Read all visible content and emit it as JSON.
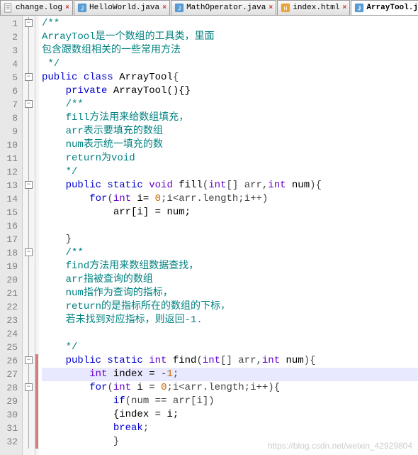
{
  "tabs": [
    {
      "label": "change.log",
      "icon": "file-icon",
      "active": false,
      "closable": true
    },
    {
      "label": "HelloWorld.java",
      "icon": "java-icon",
      "active": false,
      "closable": true
    },
    {
      "label": "MathOperator.java",
      "icon": "java-icon",
      "active": false,
      "closable": true
    },
    {
      "label": "index.html",
      "icon": "html-icon",
      "active": false,
      "closable": true
    },
    {
      "label": "ArrayTool.java",
      "icon": "java-icon",
      "active": true,
      "closable": true
    }
  ],
  "close_glyph": "×",
  "line_count": 32,
  "highlighted_line": 27,
  "fold_markers": [
    {
      "line": 1,
      "type": "minus"
    },
    {
      "line": 5,
      "type": "minus"
    },
    {
      "line": 7,
      "type": "minus"
    },
    {
      "line": 13,
      "type": "minus"
    },
    {
      "line": 18,
      "type": "minus"
    },
    {
      "line": 26,
      "type": "minus"
    },
    {
      "line": 28,
      "type": "minus"
    }
  ],
  "change_markers": [
    {
      "from": 26,
      "to": 32
    }
  ],
  "code_lines": [
    {
      "n": 1,
      "tokens": [
        {
          "t": "/**",
          "c": "c-comment"
        }
      ]
    },
    {
      "n": 2,
      "tokens": [
        {
          "t": "ArrayTool是一个数组的工具类，里面",
          "c": "c-comment"
        }
      ]
    },
    {
      "n": 3,
      "tokens": [
        {
          "t": "包含跟数组相关的一些常用方法",
          "c": "c-comment"
        }
      ]
    },
    {
      "n": 4,
      "tokens": [
        {
          "t": " */",
          "c": "c-comment"
        }
      ]
    },
    {
      "n": 5,
      "tokens": [
        {
          "t": "public ",
          "c": "c-keyword"
        },
        {
          "t": "class ",
          "c": "c-keyword"
        },
        {
          "t": "ArrayTool",
          "c": "c-id"
        },
        {
          "t": "{",
          "c": "c-op"
        }
      ]
    },
    {
      "n": 6,
      "indent": 1,
      "tokens": [
        {
          "t": "private ",
          "c": "c-keyword"
        },
        {
          "t": "ArrayTool",
          "c": "c-id"
        },
        {
          "t": "(){}"
        }
      ]
    },
    {
      "n": 7,
      "indent": 1,
      "tokens": [
        {
          "t": "/**",
          "c": "c-comment"
        }
      ]
    },
    {
      "n": 8,
      "indent": 1,
      "tokens": [
        {
          "t": "fill方法用来给数组填充，",
          "c": "c-comment"
        }
      ]
    },
    {
      "n": 9,
      "indent": 1,
      "tokens": [
        {
          "t": "arr表示要填充的数组",
          "c": "c-comment"
        }
      ]
    },
    {
      "n": 10,
      "indent": 1,
      "tokens": [
        {
          "t": "num表示统一填充的数",
          "c": "c-comment"
        }
      ]
    },
    {
      "n": 11,
      "indent": 1,
      "tokens": [
        {
          "t": "return为void",
          "c": "c-comment"
        }
      ]
    },
    {
      "n": 12,
      "indent": 1,
      "tokens": [
        {
          "t": "*/",
          "c": "c-comment"
        }
      ]
    },
    {
      "n": 13,
      "indent": 1,
      "tokens": [
        {
          "t": "public static ",
          "c": "c-keyword"
        },
        {
          "t": "void ",
          "c": "c-type"
        },
        {
          "t": "fill",
          "c": "c-id"
        },
        {
          "t": "(",
          "c": "c-op"
        },
        {
          "t": "int",
          "c": "c-type"
        },
        {
          "t": "[] arr,",
          "c": "c-op"
        },
        {
          "t": "int ",
          "c": "c-type"
        },
        {
          "t": "num",
          "c": "c-id"
        },
        {
          "t": "){",
          "c": "c-op"
        }
      ]
    },
    {
      "n": 14,
      "indent": 2,
      "tokens": [
        {
          "t": "for",
          "c": "c-keyword"
        },
        {
          "t": "(",
          "c": "c-op"
        },
        {
          "t": "int ",
          "c": "c-type"
        },
        {
          "t": "i= ",
          "c": "c-id"
        },
        {
          "t": "0",
          "c": "c-num"
        },
        {
          "t": ";i<arr.length;i++)",
          "c": "c-op"
        }
      ]
    },
    {
      "n": 15,
      "indent": 3,
      "tokens": [
        {
          "t": "arr[i] = num;",
          "c": "c-id"
        }
      ]
    },
    {
      "n": 16,
      "indent": 0,
      "tokens": []
    },
    {
      "n": 17,
      "indent": 1,
      "tokens": [
        {
          "t": "}",
          "c": "c-op"
        }
      ]
    },
    {
      "n": 18,
      "indent": 1,
      "tokens": [
        {
          "t": "/**",
          "c": "c-comment"
        }
      ]
    },
    {
      "n": 19,
      "indent": 1,
      "tokens": [
        {
          "t": "find方法用来数组数据查找，",
          "c": "c-comment"
        }
      ]
    },
    {
      "n": 20,
      "indent": 1,
      "tokens": [
        {
          "t": "arr指被查询的数组",
          "c": "c-comment"
        }
      ]
    },
    {
      "n": 21,
      "indent": 1,
      "tokens": [
        {
          "t": "num指作为查询的指标，",
          "c": "c-comment"
        }
      ]
    },
    {
      "n": 22,
      "indent": 1,
      "tokens": [
        {
          "t": "return的是指标所在的数组的下标，",
          "c": "c-comment"
        }
      ]
    },
    {
      "n": 23,
      "indent": 1,
      "tokens": [
        {
          "t": "若未找到对应指标，则返回-1.",
          "c": "c-comment"
        }
      ]
    },
    {
      "n": 24,
      "indent": 0,
      "tokens": []
    },
    {
      "n": 25,
      "indent": 1,
      "tokens": [
        {
          "t": "*/",
          "c": "c-comment"
        }
      ]
    },
    {
      "n": 26,
      "indent": 1,
      "tokens": [
        {
          "t": "public static ",
          "c": "c-keyword"
        },
        {
          "t": "int ",
          "c": "c-type"
        },
        {
          "t": "find",
          "c": "c-id"
        },
        {
          "t": "(",
          "c": "c-op"
        },
        {
          "t": "int",
          "c": "c-type"
        },
        {
          "t": "[] arr,",
          "c": "c-op"
        },
        {
          "t": "int ",
          "c": "c-type"
        },
        {
          "t": "num",
          "c": "c-id"
        },
        {
          "t": "){",
          "c": "c-op"
        }
      ]
    },
    {
      "n": 27,
      "indent": 2,
      "tokens": [
        {
          "t": "int ",
          "c": "c-type"
        },
        {
          "t": "index = ",
          "c": "c-id"
        },
        {
          "t": "-",
          "c": "c-op"
        },
        {
          "t": "1",
          "c": "c-num"
        },
        {
          "t": ";",
          "c": "c-op"
        }
      ]
    },
    {
      "n": 28,
      "indent": 2,
      "tokens": [
        {
          "t": "for",
          "c": "c-keyword"
        },
        {
          "t": "(",
          "c": "c-op"
        },
        {
          "t": "int ",
          "c": "c-type"
        },
        {
          "t": "i = ",
          "c": "c-id"
        },
        {
          "t": "0",
          "c": "c-num"
        },
        {
          "t": ";i<arr.length;i++){",
          "c": "c-op"
        }
      ]
    },
    {
      "n": 29,
      "indent": 3,
      "tokens": [
        {
          "t": "if",
          "c": "c-keyword"
        },
        {
          "t": "(num == arr[i])",
          "c": "c-op"
        }
      ]
    },
    {
      "n": 30,
      "indent": 3,
      "tokens": [
        {
          "t": "{index = i;",
          "c": "c-id"
        }
      ]
    },
    {
      "n": 31,
      "indent": 3,
      "tokens": [
        {
          "t": "break",
          "c": "c-keyword"
        },
        {
          "t": ";",
          "c": "c-op"
        }
      ]
    },
    {
      "n": 32,
      "indent": 3,
      "tokens": [
        {
          "t": "}",
          "c": "c-op"
        }
      ]
    }
  ],
  "watermark": "https://blog.csdn.net/weixin_42929804"
}
